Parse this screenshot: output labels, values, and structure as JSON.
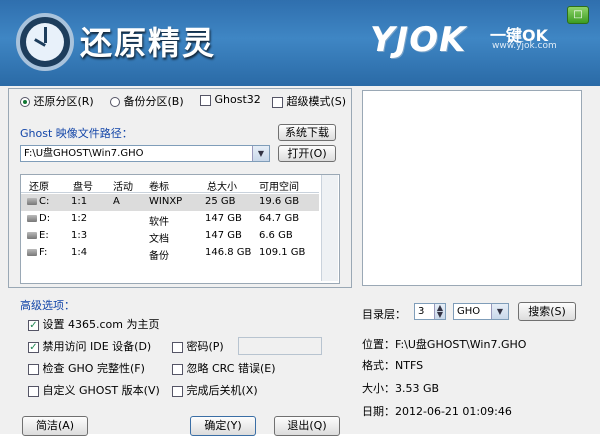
{
  "header": {
    "app_title": "还原精灵",
    "brand_logo": "YJOK",
    "brand_sub": "一键OK",
    "brand_url": "www.yjok.com",
    "close_label": "□",
    "accent": "#3f86c4"
  },
  "mode": {
    "restore_label": "还原分区",
    "restore_key": "(R)",
    "backup_label": "备份分区",
    "backup_key": "(B)",
    "ghost32_label": "Ghost32",
    "super_label": "超级模式",
    "super_key": "(S)",
    "selected": "restore"
  },
  "path": {
    "label": "Ghost 映像文件路径：",
    "download_label": "系统下载",
    "value": "F:\\U盘GHOST\\Win7.GHO",
    "open_label": "打开",
    "open_key": "(O)"
  },
  "table": {
    "headers": [
      "还原",
      "盘号",
      "活动",
      "卷标",
      "总大小",
      "可用空间"
    ],
    "rows": [
      {
        "restore": "C:",
        "disk": "1:1",
        "active": "A",
        "label": "WINXP",
        "total": "25 GB",
        "free": "19.6 GB",
        "selected": true
      },
      {
        "restore": "D:",
        "disk": "1:2",
        "active": "",
        "label": "软件",
        "total": "147 GB",
        "free": "64.7 GB"
      },
      {
        "restore": "E:",
        "disk": "1:3",
        "active": "",
        "label": "文档",
        "total": "147 GB",
        "free": "6.6 GB"
      },
      {
        "restore": "F:",
        "disk": "1:4",
        "active": "",
        "label": "备份",
        "total": "146.8 GB",
        "free": "109.1 GB"
      }
    ]
  },
  "advanced": {
    "title": "高级选项：",
    "homepage_label": "设置 4365.com 为主页",
    "ide_label": "禁用访问 IDE 设备",
    "ide_key": "(D)",
    "password_label": "密码",
    "password_key": "(P)",
    "check_gho_label": "检查 GHO 完整性",
    "check_gho_key": "(F)",
    "ignore_crc_label": "忽略 CRC 错误",
    "ignore_crc_key": "(E)",
    "custom_ghost_label": "自定义 GHOST 版本",
    "custom_ghost_key": "(V)",
    "shutdown_label": "完成后关机",
    "shutdown_key": "(X)",
    "check_mark": "✓"
  },
  "right": {
    "dir_level_label": "目录层：",
    "dir_level_value": "3",
    "ext_value": "GHO",
    "search_label": "搜索",
    "search_key": "(S)",
    "location": "位置：F:\\U盘GHOST\\Win7.GHO",
    "format": "格式：NTFS",
    "size": "大小：3.53 GB",
    "date": "日期：2012-06-21   01:09:46"
  },
  "footer": {
    "advanced_label": "简洁",
    "advanced_key": "(A)",
    "ok_label": "确定",
    "ok_key": "(Y)",
    "exit_label": "退出",
    "exit_key": "(Q)"
  }
}
